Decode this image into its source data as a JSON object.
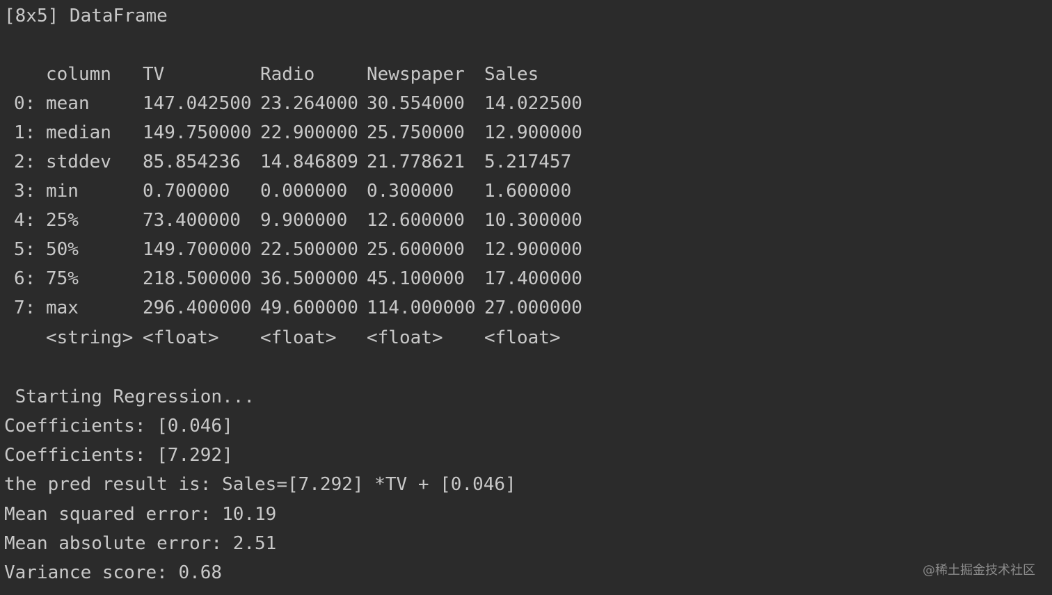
{
  "console": {
    "header": "[8x5] DataFrame",
    "table": {
      "columns": [
        "column",
        "TV",
        "Radio",
        "Newspaper",
        "Sales"
      ],
      "rows": [
        {
          "index": "0:",
          "cells": [
            "mean",
            "147.042500",
            "23.264000",
            "30.554000",
            "14.022500"
          ]
        },
        {
          "index": "1:",
          "cells": [
            "median",
            "149.750000",
            "22.900000",
            "25.750000",
            "12.900000"
          ]
        },
        {
          "index": "2:",
          "cells": [
            "stddev",
            "85.854236",
            "14.846809",
            "21.778621",
            "5.217457"
          ]
        },
        {
          "index": "3:",
          "cells": [
            "min",
            "0.700000",
            "0.000000",
            "0.300000",
            "1.600000"
          ]
        },
        {
          "index": "4:",
          "cells": [
            "25%",
            "73.400000",
            "9.900000",
            "12.600000",
            "10.300000"
          ]
        },
        {
          "index": "5:",
          "cells": [
            "50%",
            "149.700000",
            "22.500000",
            "25.600000",
            "12.900000"
          ]
        },
        {
          "index": "6:",
          "cells": [
            "75%",
            "218.500000",
            "36.500000",
            "45.100000",
            "17.400000"
          ]
        },
        {
          "index": "7:",
          "cells": [
            "max",
            "296.400000",
            "49.600000",
            "114.000000",
            "27.000000"
          ]
        }
      ],
      "types": [
        "<string>",
        "<float>",
        "<float>",
        "<float>",
        "<float>"
      ]
    },
    "output_lines": [
      " Starting Regression...",
      "Coefficients: [0.046]",
      "Coefficients: [7.292]",
      "the pred result is: Sales=[7.292] *TV + [0.046]",
      "Mean squared error: 10.19",
      "Mean absolute error: 2.51",
      "Variance score: 0.68"
    ]
  },
  "watermark": "@稀土掘金技术社区"
}
